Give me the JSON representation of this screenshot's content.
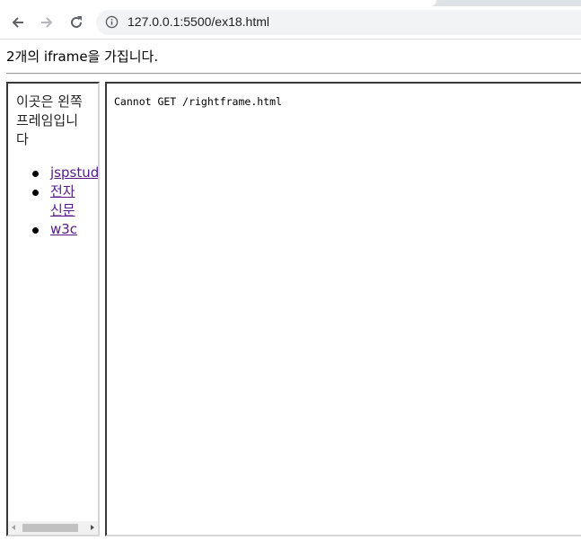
{
  "browser": {
    "url": "127.0.0.1:5500/ex18.html",
    "back_icon": "arrow-left-icon",
    "forward_icon": "arrow-right-icon",
    "reload_icon": "reload-icon",
    "info_icon": "info-circle-icon"
  },
  "page": {
    "intro_text": "2개의 iframe을 가집니다."
  },
  "left_frame": {
    "heading": "이곳은 왼쪽 프레임입니다",
    "links": [
      {
        "label": "jspstudy"
      },
      {
        "label": "전자신문"
      },
      {
        "label": "w3c"
      }
    ],
    "link_color": "#551a8b"
  },
  "right_frame": {
    "message": "Cannot GET /rightframe.html"
  }
}
